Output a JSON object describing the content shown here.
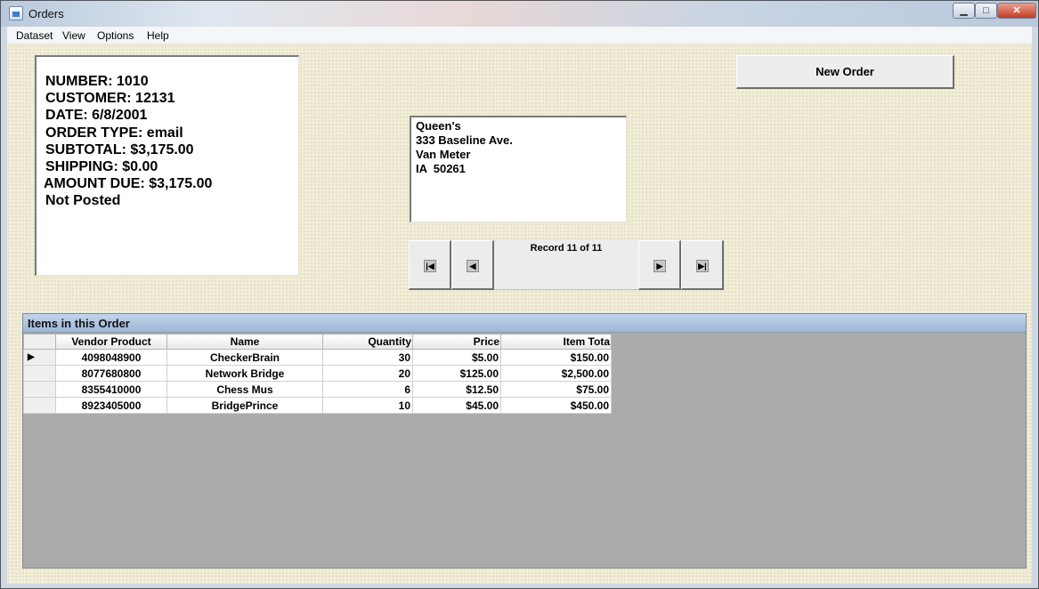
{
  "window": {
    "title": "Orders",
    "minimize": "▁",
    "maximize": "□",
    "close": "✕"
  },
  "menu": [
    "Dataset",
    "View",
    "Options",
    "Help"
  ],
  "order_info": {
    "number": "NUMBER: 1010",
    "customer": "CUSTOMER: 12131",
    "date": "DATE: 6/8/2001",
    "order_type": "ORDER TYPE: email",
    "subtotal": "SUBTOTAL: $3,175.00",
    "shipping": "SHIPPING: $0.00",
    "amount_due": "AMOUNT DUE: $3,175.00",
    "status": "Not Posted"
  },
  "address": [
    "Queen's",
    "333 Baseline Ave.",
    "Van Meter",
    "IA  50261"
  ],
  "navigator": {
    "record_text": "Record 11 of 11",
    "first_icon": "first-record-icon",
    "prev_icon": "prev-record-icon",
    "next_icon": "next-record-icon",
    "last_icon": "last-record-icon"
  },
  "new_order_label": "New Order",
  "items": {
    "caption": "Items in this Order",
    "columns": [
      "Vendor Product",
      "Name",
      "Quantity",
      "Price",
      "Item Tota"
    ],
    "current_row_marker": "▶",
    "rows": [
      [
        "4098048900",
        "CheckerBrain",
        "30",
        "$5.00",
        "$150.00"
      ],
      [
        "8077680800",
        "Network Bridge",
        "20",
        "$125.00",
        "$2,500.00"
      ],
      [
        "8355410000",
        "Chess Mus",
        "6",
        "$12.50",
        "$75.00"
      ],
      [
        "8923405000",
        "BridgePrince",
        "10",
        "$45.00",
        "$450.00"
      ]
    ]
  }
}
